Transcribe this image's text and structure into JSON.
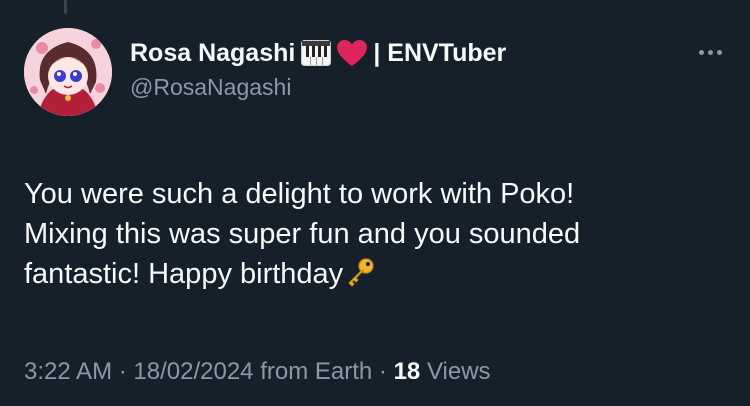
{
  "author": {
    "display_name": "Rosa Nagashi",
    "name_suffix": "| ENVTuber",
    "handle": "@RosaNagashi",
    "emoji": [
      "piano-keys",
      "red-heart"
    ]
  },
  "tweet": {
    "lines": [
      "You were such a delight to work with Poko!",
      "Mixing this was super fun and you sounded",
      "fantastic! Happy birthday"
    ],
    "end_emoji": "key",
    "time": "3:22 AM",
    "date": "18/02/2024",
    "source": "from Earth",
    "views_count": "18",
    "views_label": "Views",
    "separator": "·"
  },
  "colors": {
    "background": "#15202b",
    "text_primary": "#f7f9f9",
    "text_secondary": "#8b98a5",
    "heart": "#e0245e"
  }
}
